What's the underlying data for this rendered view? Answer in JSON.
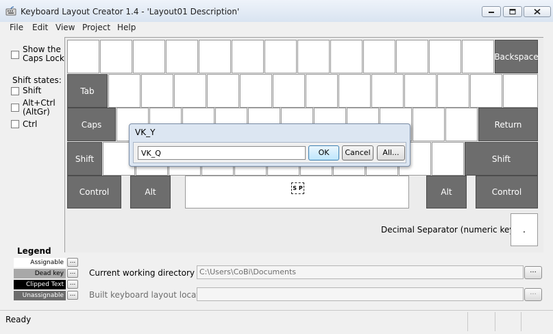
{
  "window": {
    "title": "Keyboard Layout Creator 1.4 - 'Layout01 Description'",
    "controls": [
      "minimize-icon",
      "maximize-icon",
      "close-icon"
    ]
  },
  "menu": [
    "File",
    "Edit",
    "View",
    "Project",
    "Help"
  ],
  "sidebar": {
    "caps_lock_line1": "Show the",
    "caps_lock_line2": "Caps Lock",
    "shift_states_label": "Shift states:",
    "shift": "Shift",
    "altgr_line1": "Alt+Ctrl",
    "altgr_line2": "(AltGr)",
    "ctrl": "Ctrl"
  },
  "keyboard": {
    "backspace": "Backspace",
    "tab": "Tab",
    "caps": "Caps",
    "return": "Return",
    "shift_left": "Shift",
    "shift_right": "Shift",
    "control_left": "Control",
    "alt_left": "Alt",
    "space": "S P",
    "alt_right": "Alt",
    "control_right": "Control",
    "decimal_separator_label": "Decimal Separator (numeric keypad)",
    "decimal_separator_value": "."
  },
  "dialog": {
    "title": "VK_Y",
    "input_value": "VK_Q",
    "ok": "OK",
    "cancel": "Cancel",
    "all": "All..."
  },
  "legend": {
    "title": "Legend",
    "items": [
      {
        "label": "Assignable",
        "bg": "#ffffff",
        "fg": "#000000"
      },
      {
        "label": "Dead key",
        "bg": "#a8a8a8",
        "fg": "#000000"
      },
      {
        "label": "Clipped Text",
        "bg": "#000000",
        "fg": "#ffffff"
      },
      {
        "label": "Unassignable",
        "bg": "#6d6d6d",
        "fg": "#ffffff"
      }
    ],
    "button": "..."
  },
  "paths": {
    "working_dir_label": "Current working directory",
    "working_dir_value": "C:\\Users\\CoBi\\Documents",
    "build_location_label": "Built keyboard layout location",
    "build_location_value": "",
    "browse": "..."
  },
  "status": {
    "text": "Ready"
  }
}
